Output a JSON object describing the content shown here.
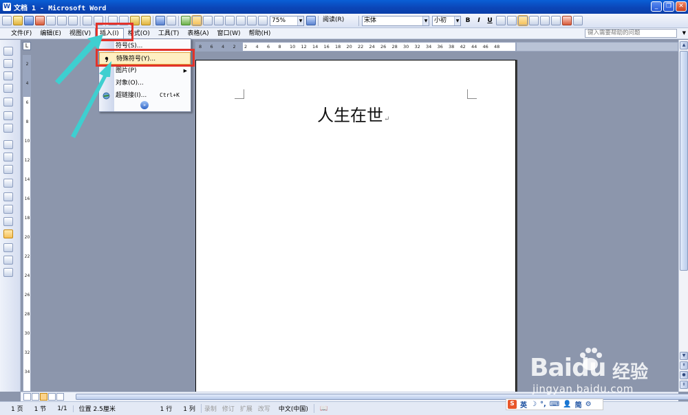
{
  "window": {
    "title": "文档 1 - Microsoft Word",
    "app_icon_text": "W"
  },
  "toolbar": {
    "zoom": "75%",
    "read_label": "阅读(R)",
    "font_name": "宋体",
    "font_size": "小初",
    "bold": "B",
    "italic": "I",
    "underline": "U"
  },
  "menubar": {
    "items": [
      {
        "label": "文件(F)"
      },
      {
        "label": "编辑(E)"
      },
      {
        "label": "视图(V)"
      },
      {
        "label": "插入(I)"
      },
      {
        "label": "格式(O)"
      },
      {
        "label": "工具(T)"
      },
      {
        "label": "表格(A)"
      },
      {
        "label": "窗口(W)"
      },
      {
        "label": "帮助(H)"
      }
    ],
    "help_placeholder": "键入需要帮助的问题"
  },
  "insert_menu": {
    "items": [
      {
        "label": "符号(S)..."
      },
      {
        "label": "特殊符号(Y)..."
      },
      {
        "label": "图片(P)"
      },
      {
        "label": "对象(O)..."
      },
      {
        "label": "超链接(I)..."
      }
    ],
    "hyperlink_shortcut": "Ctrl+K"
  },
  "ruler": {
    "horizontal_ticks": [
      "8",
      "6",
      "4",
      "2",
      "2",
      "4",
      "6",
      "8",
      "10",
      "12",
      "14",
      "16",
      "18",
      "20",
      "22",
      "24",
      "26",
      "28",
      "30",
      "32",
      "34",
      "36",
      "38",
      "42",
      "44",
      "46",
      "48"
    ],
    "vertical_ticks": [
      "2",
      "4",
      "6",
      "8",
      "10",
      "12",
      "14",
      "16",
      "18",
      "20",
      "22",
      "24",
      "26",
      "28",
      "30",
      "32",
      "34"
    ]
  },
  "document": {
    "text": "人生在世",
    "paragraph_mark": "↵"
  },
  "status": {
    "page": "1 页",
    "section": "1 节",
    "pages": "1/1",
    "position": "位置 2.5厘米",
    "line": "1 行",
    "column": "1 列",
    "rec": "录制",
    "trk": "修订",
    "ext": "扩展",
    "ovr": "改写",
    "language": "中文(中国)"
  },
  "ime": {
    "logo": "S",
    "lang": "英",
    "simplified": "简"
  },
  "watermark": {
    "brand": "Baidu",
    "cn": "经验",
    "url": "jingyan.baidu.com"
  },
  "colors": {
    "highlight": "#e3322a",
    "arrow": "#3ecfd0",
    "title_bar": "#0b46b8"
  }
}
